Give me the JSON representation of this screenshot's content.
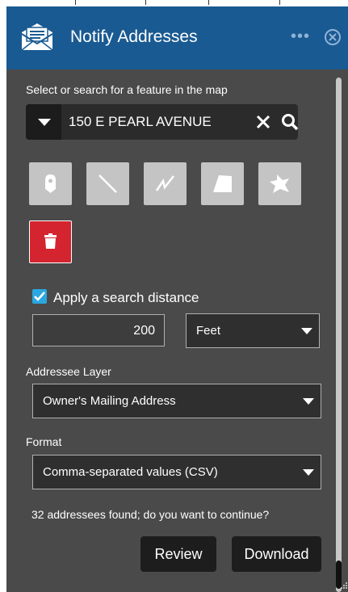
{
  "header": {
    "title": "Notify Addresses",
    "more_glyph": "•••",
    "icons": [
      "envelope-icon",
      "more-icon",
      "close-icon"
    ]
  },
  "select_section": {
    "label": "Select or search for a feature in the map",
    "search_value": "150 E PEARL AVENUE",
    "icons": [
      "dropdown-arrow-icon",
      "clear-icon",
      "search-icon"
    ]
  },
  "draw_tools": [
    "point-tool-icon",
    "line-tool-icon",
    "polyline-tool-icon",
    "polygon-tool-icon",
    "freehand-polygon-tool-icon"
  ],
  "delete_tool": "trash-icon",
  "search_distance": {
    "checkbox_label": "Apply a search distance",
    "checked": true,
    "value": "200",
    "unit": "Feet"
  },
  "addressee_layer": {
    "label": "Addressee Layer",
    "value": "Owner's Mailing Address"
  },
  "format": {
    "label": "Format",
    "value": "Comma-separated values (CSV)"
  },
  "status_message": "32 addressees found; do you want to continue?",
  "actions": {
    "review_label": "Review",
    "download_label": "Download"
  },
  "colors": {
    "header_bg": "#1a5a92",
    "panel_bg": "#4a4a4a",
    "delete_red": "#d42430",
    "checkbox_blue": "#2aa7e0"
  }
}
